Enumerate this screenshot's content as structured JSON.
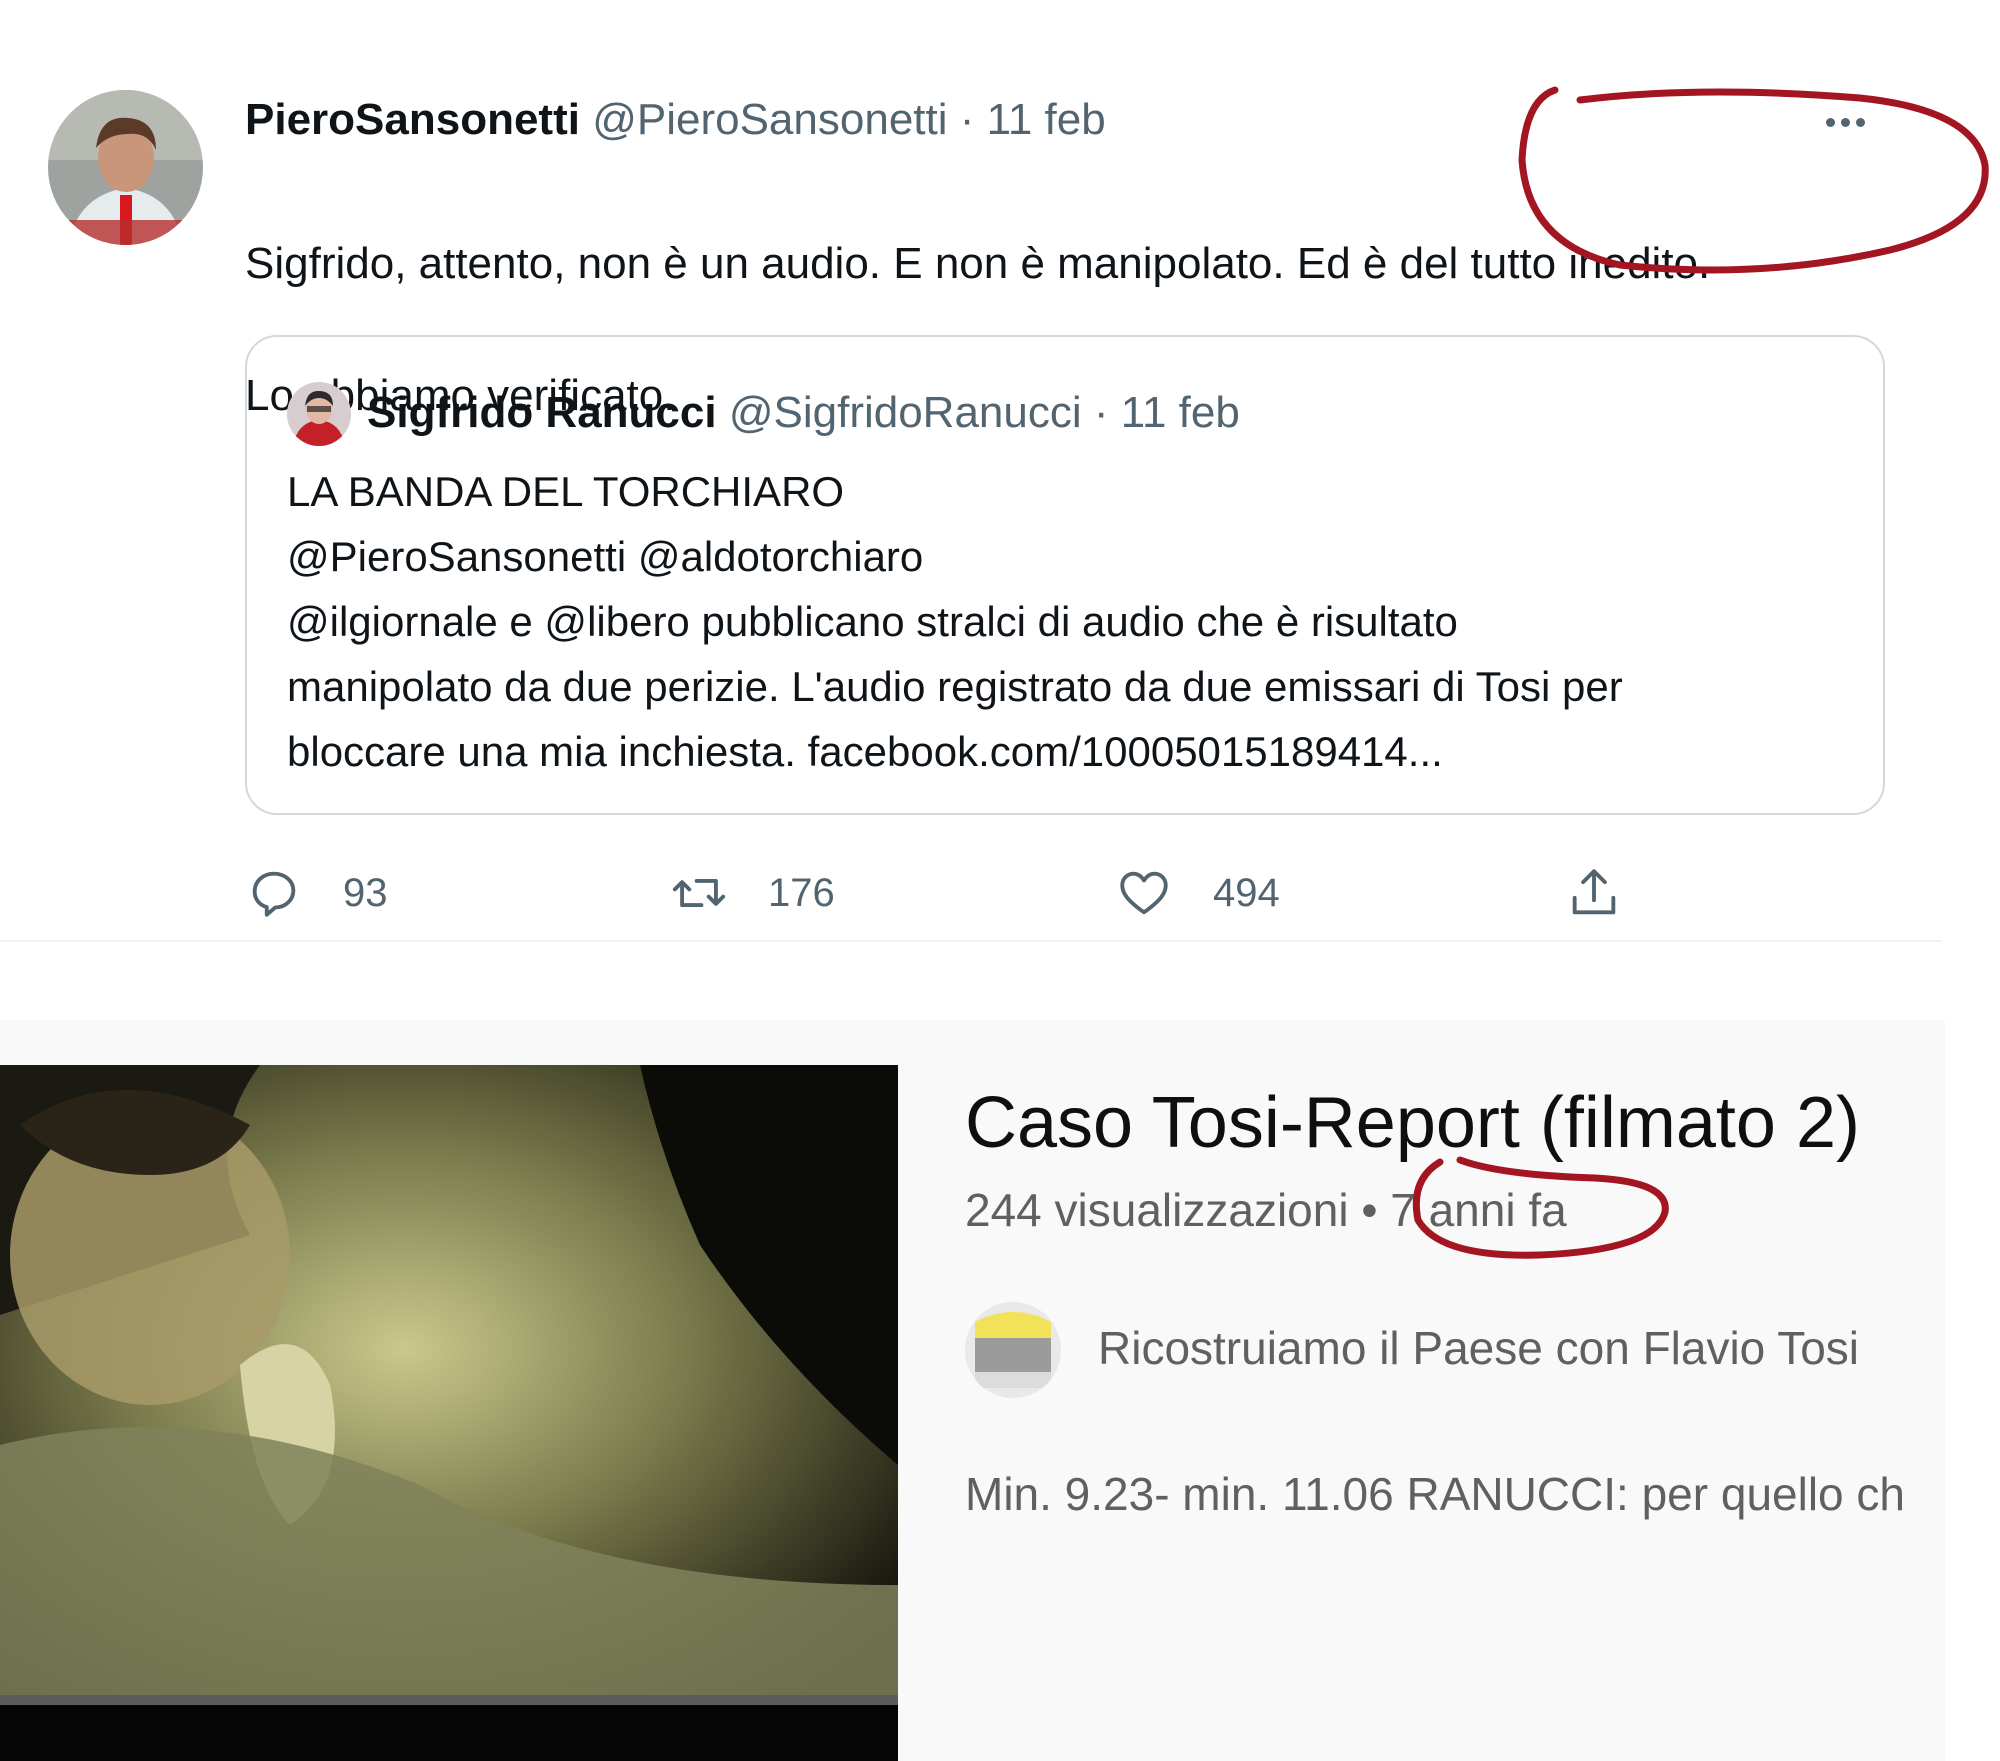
{
  "tweet": {
    "author_name": "PieroSansonetti",
    "author_handle": "@PieroSansonetti",
    "separator": "·",
    "date": "11 feb",
    "text_line1": "Sigfrido, attento, non è un audio. E non è manipolato. Ed è del tutto inedito.",
    "text_line2": "Lo abbiamo verificato.",
    "quote": {
      "author_name": "Sigfrido Ranucci",
      "author_handle": "@SigfridoRanucci",
      "separator": "·",
      "date": "11 feb",
      "line1": "LA BANDA DEL TORCHIARO",
      "line2": "@PieroSansonetti @aldotorchiaro",
      "line3": "@ilgiornale e @libero pubblicano stralci di audio che è risultato",
      "line4": "manipolato da due perizie. L'audio registrato da due emissari di Tosi per",
      "line5": "bloccare una mia inchiesta.  facebook.com/10005015189414..."
    },
    "actions": {
      "replies": "93",
      "retweets": "176",
      "likes": "494",
      "reply_icon": "reply-icon",
      "retweet_icon": "retweet-icon",
      "like_icon": "heart-icon",
      "share_icon": "share-icon"
    }
  },
  "video": {
    "title": "Caso Tosi-Report (filmato 2)",
    "views": "244 visualizzazioni",
    "separator": "•",
    "age": "7 anni fa",
    "channel_name": "Ricostruiamo il Paese con Flavio Tosi",
    "description": "Min. 9.23- min. 11.06 RANUCCI: per quello ch"
  },
  "annotation_color": "#a31621"
}
